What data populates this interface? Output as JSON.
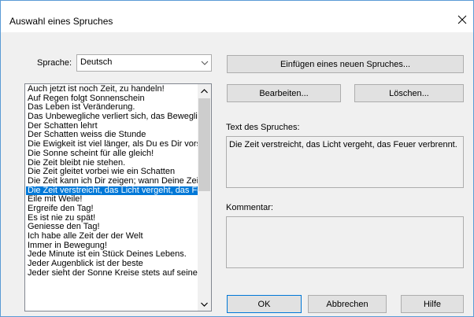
{
  "window": {
    "title": "Auswahl eines Spruches"
  },
  "language": {
    "label": "Sprache:",
    "selected": "Deutsch"
  },
  "sayings": {
    "selected_index": 12,
    "items": [
      "Auch jetzt ist noch Zeit, zu handeln!",
      "Auf Regen folgt Sonnenschein",
      "Das Leben ist Veränderung.",
      "Das Unbewegliche verliert sich, das Bewegliche",
      "Der Schatten lehrt",
      "Der Schatten weiss die Stunde",
      "Die Ewigkeit ist viel länger, als Du es Dir vorstellst",
      "Die Sonne scheint für alle gleich!",
      "Die Zeit bleibt nie stehen.",
      "Die Zeit gleitet vorbei wie ein Schatten",
      "Die Zeit kann ich Dir zeigen; wann Deine Zeit",
      "Die Zeit verstreicht, das Licht vergeht, das Feuer verbrennt.",
      "Eile mit Weile!",
      "Ergreife den Tag!",
      "Es ist nie zu spät!",
      "Geniesse den Tag!",
      "Ich habe alle Zeit der der Welt",
      "Immer in Bewegung!",
      "Jede Minute ist ein Stück Deines Lebens.",
      "Jeder Augenblick ist der beste",
      "Jeder sieht der Sonne Kreise stets auf seine Weise"
    ]
  },
  "buttons": {
    "insert": "Einfügen eines neuen Spruches...",
    "edit": "Bearbeiten...",
    "delete": "Löschen...",
    "ok": "OK",
    "cancel": "Abbrechen",
    "help": "Hilfe"
  },
  "text_section": {
    "label": "Text des Spruches:",
    "value": "Die Zeit verstreicht, das Licht vergeht, das Feuer verbrennt."
  },
  "comment_section": {
    "label": "Kommentar:",
    "value": ""
  },
  "icons": {
    "close": "close-icon",
    "dropdown": "chevron-down-icon",
    "scroll_up": "scroll-up-icon",
    "scroll_down": "scroll-down-icon"
  },
  "colors": {
    "selection": "#0078d7",
    "window_bg": "#f0f0f0",
    "button_bg": "#e1e1e1"
  }
}
